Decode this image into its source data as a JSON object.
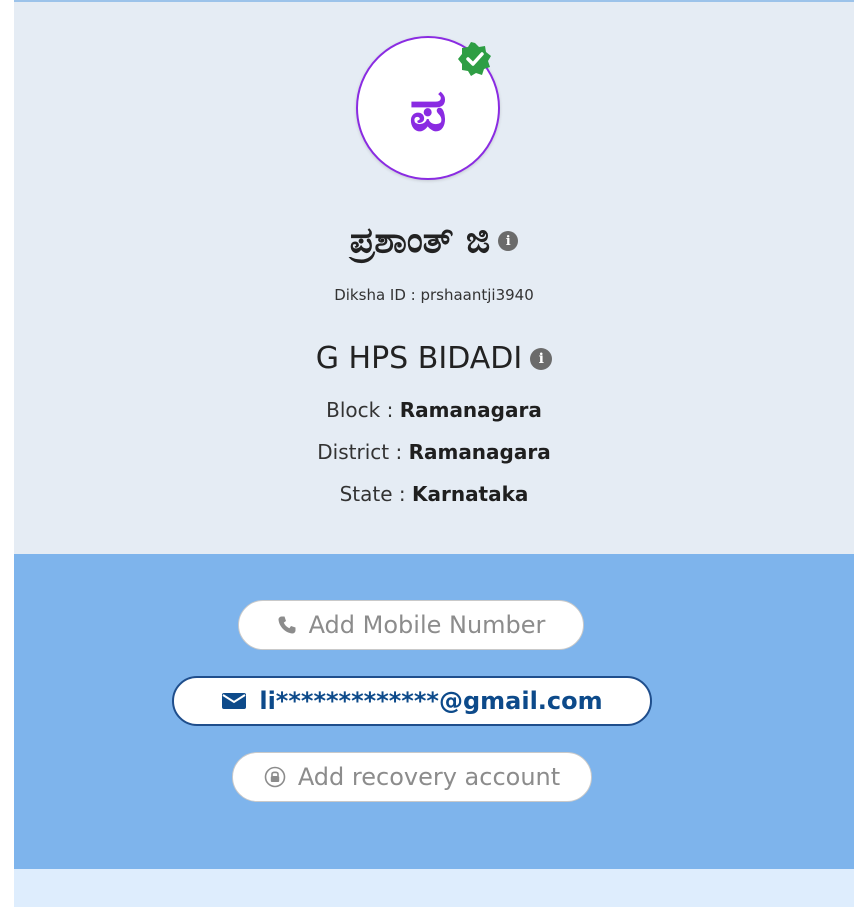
{
  "profile": {
    "avatar_initial": "ಪ",
    "name": "ಪ್ರಶಾಂತ್ ಜಿ",
    "diksha_id_label": "Diksha ID : ",
    "diksha_id_value": "prshaantji3940",
    "school": "G HPS BIDADI",
    "block_label": "Block : ",
    "block_value": "Ramanagara",
    "district_label": "District : ",
    "district_value": "Ramanagara",
    "state_label": "State : ",
    "state_value": "Karnataka"
  },
  "contact": {
    "mobile_label": "Add Mobile Number",
    "email_value": "li*************@gmail.com",
    "recovery_label": "Add recovery account"
  },
  "colors": {
    "avatar_accent": "#8a2be2",
    "verified_badge": "#2e9e44",
    "profile_bg": "#e5ecf4",
    "contact_bg": "#7eb4ec",
    "email_text": "#0d4a8a"
  },
  "icons": {
    "verified": "verified-check-icon",
    "info": "info-icon",
    "phone": "phone-icon",
    "email": "envelope-icon",
    "recovery": "lock-circle-icon"
  }
}
